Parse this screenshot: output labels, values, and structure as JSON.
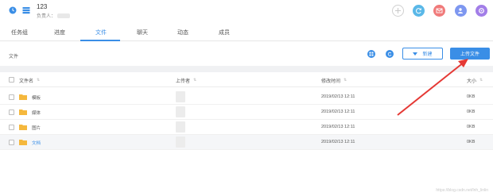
{
  "project": {
    "title": "123",
    "owner_label": "负责人："
  },
  "header_actions": [
    {
      "icon": "plus-icon",
      "color": "#cfcfcf"
    },
    {
      "icon": "refresh-icon",
      "color": "#5ab8e8"
    },
    {
      "icon": "mail-icon",
      "color": "#f07a7a"
    },
    {
      "icon": "user-edit-icon",
      "color": "#7e97f0"
    },
    {
      "icon": "settings-icon",
      "color": "#a27ee8"
    }
  ],
  "tabs": [
    {
      "label": "任务组"
    },
    {
      "label": "进度"
    },
    {
      "label": "文件",
      "active": true
    },
    {
      "label": "聊天"
    },
    {
      "label": "动态"
    },
    {
      "label": "成员"
    }
  ],
  "toolbar": {
    "breadcrumb": "文件",
    "new_label": "新建",
    "upload_label": "上传文件"
  },
  "table": {
    "columns": {
      "name": "文件名",
      "uploader": "上传者",
      "modified": "修改时间",
      "size": "大小"
    },
    "rows": [
      {
        "name": "模板",
        "modified": "2019/02/13 12:11",
        "size": "0KB"
      },
      {
        "name": "媒体",
        "modified": "2019/02/13 12:11",
        "size": "0KB"
      },
      {
        "name": "图片",
        "modified": "2019/02/13 12:11",
        "size": "0KB"
      },
      {
        "name": "文档",
        "modified": "2019/02/13 12:11",
        "size": "0KB",
        "hovered": true
      }
    ]
  },
  "colors": {
    "accent": "#3a8ee6",
    "folder": "#f5b83d",
    "annotation_arrow": "#e53935"
  },
  "watermark": "https://blog.csdn.net/lnh_linlin"
}
